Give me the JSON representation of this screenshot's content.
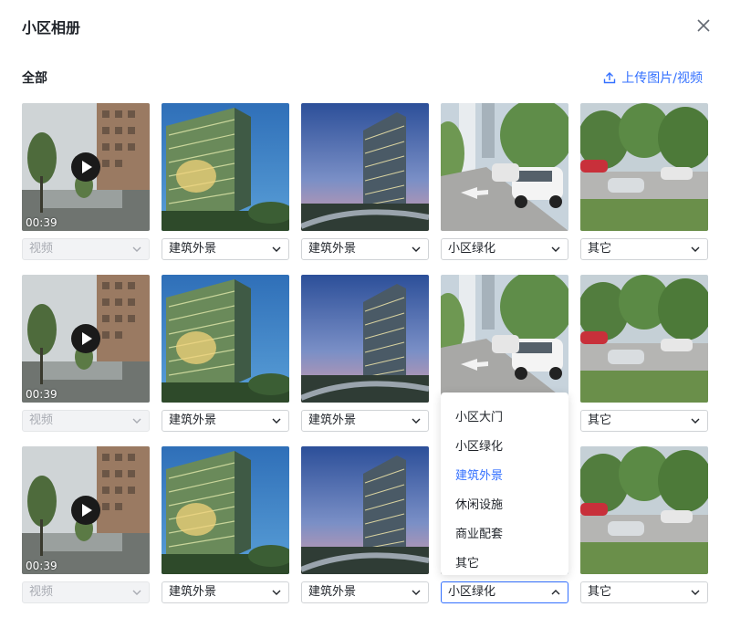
{
  "dialog": {
    "title": "小区相册",
    "close_icon": "close-icon"
  },
  "section": {
    "title": "全部"
  },
  "upload": {
    "label": "上传图片/视频",
    "icon": "upload-icon",
    "color": "#3370ff"
  },
  "rows": [
    [
      {
        "kind": "video",
        "duration": "00:39",
        "category": "视频",
        "disabled": true
      },
      {
        "kind": "building-a",
        "category": "建筑外景"
      },
      {
        "kind": "building-b",
        "category": "建筑外景"
      },
      {
        "kind": "street",
        "category": "小区绿化"
      },
      {
        "kind": "parking",
        "category": "其它"
      }
    ],
    [
      {
        "kind": "video",
        "duration": "00:39",
        "category": "视频",
        "disabled": true
      },
      {
        "kind": "building-a",
        "category": "建筑外景"
      },
      {
        "kind": "building-b",
        "category": "建筑外景"
      },
      {
        "kind": "street",
        "category": "小区绿化"
      },
      {
        "kind": "parking",
        "category": "其它"
      }
    ],
    [
      {
        "kind": "video",
        "duration": "00:39",
        "category": "视频",
        "disabled": true
      },
      {
        "kind": "building-a",
        "category": "建筑外景"
      },
      {
        "kind": "building-b",
        "category": "建筑外景"
      },
      {
        "kind": "street",
        "category": "小区绿化",
        "open": true
      },
      {
        "kind": "parking",
        "category": "其它"
      }
    ]
  ],
  "dropdown": {
    "options": [
      "小区大门",
      "小区绿化",
      "建筑外景",
      "休闲设施",
      "商业配套",
      "其它"
    ],
    "highlighted": "建筑外景"
  }
}
